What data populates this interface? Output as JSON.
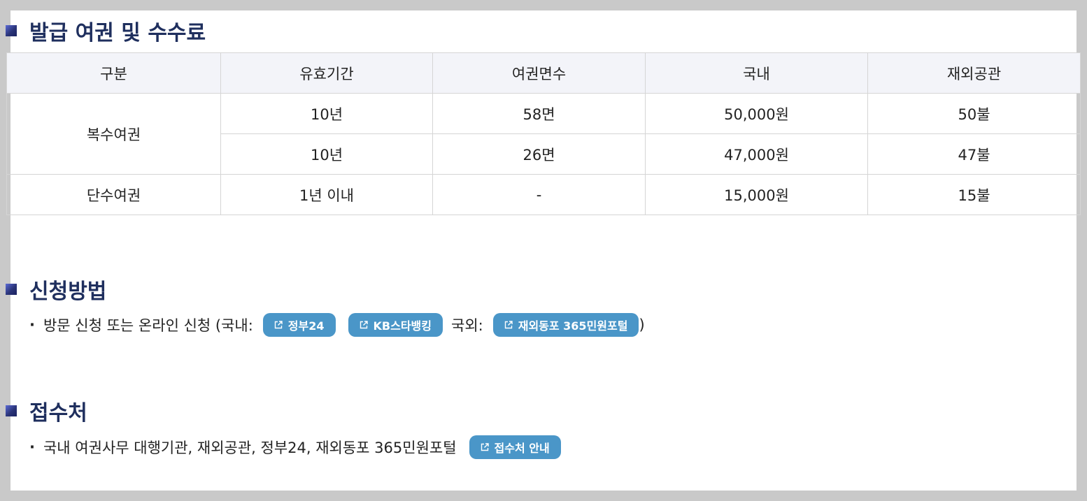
{
  "sections": {
    "fees": {
      "title": "발급 여권 및 수수료"
    },
    "apply": {
      "title": "신청방법",
      "text_prefix": "방문 신청 또는 온라인 신청 (국내:",
      "overseas_label": "국외:",
      "text_suffix": ")",
      "links": [
        {
          "label": "정부24"
        },
        {
          "label": "KB스타뱅킹"
        },
        {
          "label": "재외동포 365민원포털"
        }
      ]
    },
    "reception": {
      "title": "접수처",
      "text": "국내 여권사무 대행기관, 재외공관, 정부24, 재외동포 365민원포털",
      "link_label": "접수처 안내"
    }
  },
  "table": {
    "headers": [
      "구분",
      "유효기간",
      "여권면수",
      "국내",
      "재외공관"
    ],
    "rows": [
      {
        "type": "복수여권",
        "validity": "10년",
        "pages": "58면",
        "domestic": "50,000원",
        "overseas": "50불"
      },
      {
        "type": "복수여권",
        "validity": "10년",
        "pages": "26면",
        "domestic": "47,000원",
        "overseas": "47불"
      },
      {
        "type": "단수여권",
        "validity": "1년 이내",
        "pages": "-",
        "domestic": "15,000원",
        "overseas": "15불"
      }
    ]
  },
  "colors": {
    "title": "#1f2f5e",
    "button": "#4a96c8",
    "header_bg": "#f3f4f9",
    "border": "#d5d5d5"
  },
  "icons": {
    "bullet": "square-bullet-icon",
    "external": "external-link-icon"
  }
}
